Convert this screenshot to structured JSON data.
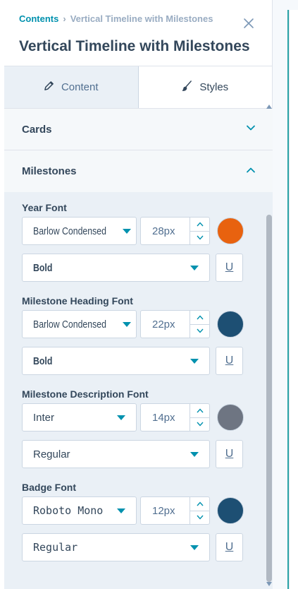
{
  "breadcrumb": {
    "parent": "Contents",
    "separator": "›",
    "current": "Vertical Timeline with Milestones"
  },
  "title": "Vertical Timeline with Milestones",
  "tabs": [
    {
      "label": "Content",
      "icon": "pencil-icon",
      "active": false
    },
    {
      "label": "Styles",
      "icon": "brush-icon",
      "active": true
    }
  ],
  "sections": {
    "cards": {
      "label": "Cards",
      "expanded": false
    },
    "milestones": {
      "label": "Milestones",
      "expanded": true
    }
  },
  "groups": [
    {
      "label": "Year Font",
      "font": "Barlow Condensed",
      "size": "28px",
      "weight": "Bold",
      "color": "#e8620f"
    },
    {
      "label": "Milestone Heading Font",
      "font": "Barlow Condensed",
      "size": "22px",
      "weight": "Bold",
      "color": "#1d4f73"
    },
    {
      "label": "Milestone Description Font",
      "font": "Inter",
      "size": "14px",
      "weight": "Regular",
      "color": "#6e7582"
    },
    {
      "label": "Badge Font",
      "font": "Roboto Mono",
      "size": "12px",
      "weight": "Regular",
      "color": "#1d4f73"
    }
  ],
  "underline_label": "U"
}
